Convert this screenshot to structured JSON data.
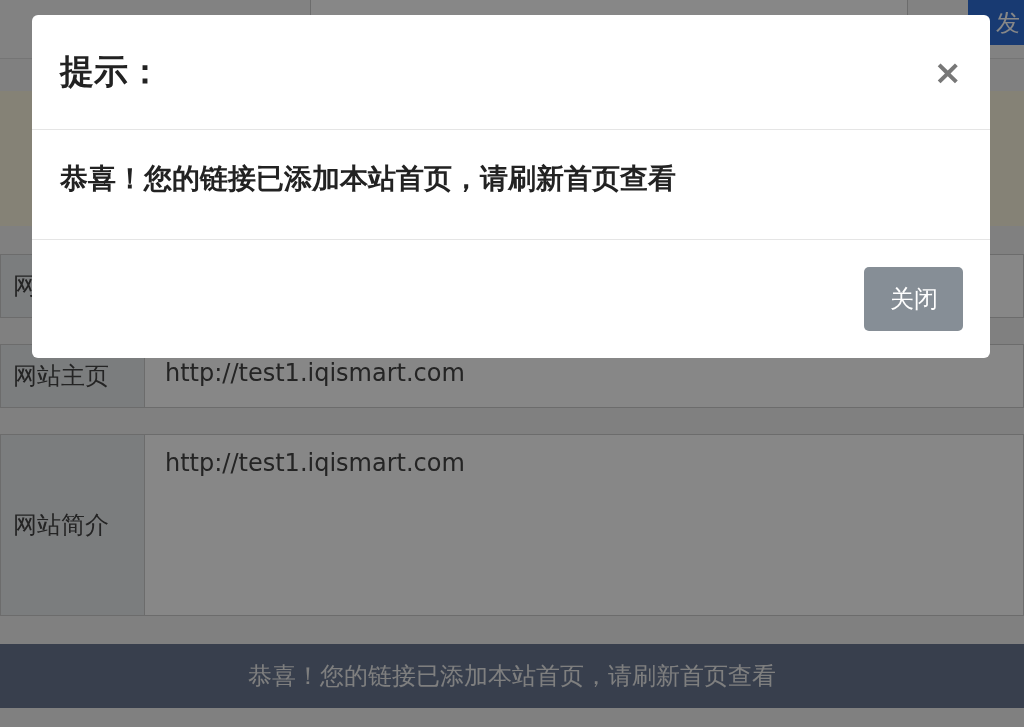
{
  "nav": {
    "button": "发"
  },
  "form": {
    "rows": [
      {
        "label": "网",
        "value": "",
        "kind": "input"
      },
      {
        "label": "网站主页",
        "value": "http://test1.iqismart.com",
        "kind": "input"
      },
      {
        "label": "网站简介",
        "value": "http://test1.iqismart.com",
        "kind": "textarea"
      }
    ]
  },
  "footer": {
    "message": "恭喜！您的链接已添加本站首页，请刷新首页查看"
  },
  "modal": {
    "title": "提示：",
    "close": "×",
    "body": "恭喜！您的链接已添加本站首页，请刷新首页查看",
    "button": "关闭"
  }
}
